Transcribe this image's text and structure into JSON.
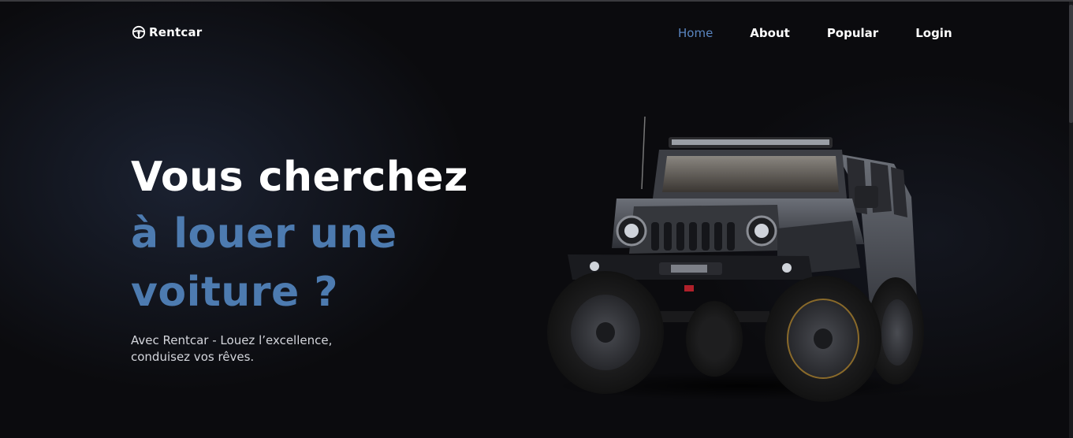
{
  "nav": {
    "logo_text": "Rentcar",
    "logo_icon": "steering-wheel-icon",
    "items": [
      {
        "label": "Home",
        "active": true
      },
      {
        "label": "About",
        "active": false
      },
      {
        "label": "Popular",
        "active": false
      },
      {
        "label": "Login",
        "active": false
      }
    ]
  },
  "hero": {
    "title_line1": "Vous cherchez",
    "title_line2": "à louer une",
    "title_line3": "voiture ?",
    "subtitle": "Avec Rentcar - Louez l’excellence, conduisez vos rêves.",
    "image": "jeep-wrangler-black-suv"
  },
  "colors": {
    "background": "#0b0b0e",
    "accent": "#4d7bb0",
    "active_link": "#5a86c0",
    "text": "#ffffff",
    "subtitle_text": "#d4d6dc"
  }
}
